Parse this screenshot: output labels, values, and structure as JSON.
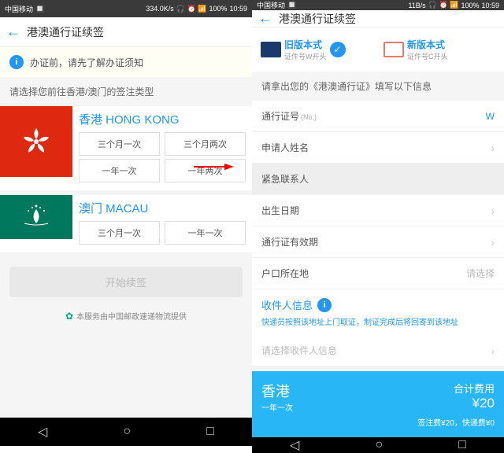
{
  "status": {
    "carrier": "中国移动",
    "speed": "334.0K/s",
    "battery": "100%",
    "time_left": "10:59",
    "speed_right": "11B/s",
    "time_right": "10:59"
  },
  "header": {
    "title": "港澳通行证续签"
  },
  "notice": {
    "text": "办证前，请先了解办证须知"
  },
  "left": {
    "section": "请选择您前往香港/澳门的签注类型",
    "hk": {
      "name": "香港 HONG KONG",
      "opts": [
        "三个月一次",
        "三个月两次",
        "一年一次",
        "一年两次"
      ]
    },
    "macau": {
      "name": "澳门 MACAU",
      "opts": [
        "三个月一次",
        "一年一次"
      ]
    },
    "start": "开始续签",
    "footer": "本服务由中国邮政速递物流提供"
  },
  "right": {
    "type_old": {
      "title": "旧版本式",
      "sub": "证件号W开头"
    },
    "type_new": {
      "title": "新版本式",
      "sub": "证件号C开头"
    },
    "form_title": "请拿出您的《港澳通行证》填写以下信息",
    "rows": {
      "permit_label": "通行证号",
      "permit_sub": "(No.)",
      "permit_val": "W",
      "name": "申请人姓名",
      "contact": "紧急联系人",
      "dob": "出生日期",
      "expiry": "通行证有效期",
      "residence": "户口所在地",
      "residence_placeholder": "请选择"
    },
    "recipient": {
      "title": "收件人信息",
      "sub": "快递员按照该地址上门取证，制证完成后将回寄到该地址",
      "select": "请选择收件人信息"
    },
    "price": {
      "dest": "香港",
      "freq": "一年一次",
      "total_label": "合计费用",
      "total_val": "¥20",
      "detail": "签注费¥20，快递费¥0"
    }
  }
}
